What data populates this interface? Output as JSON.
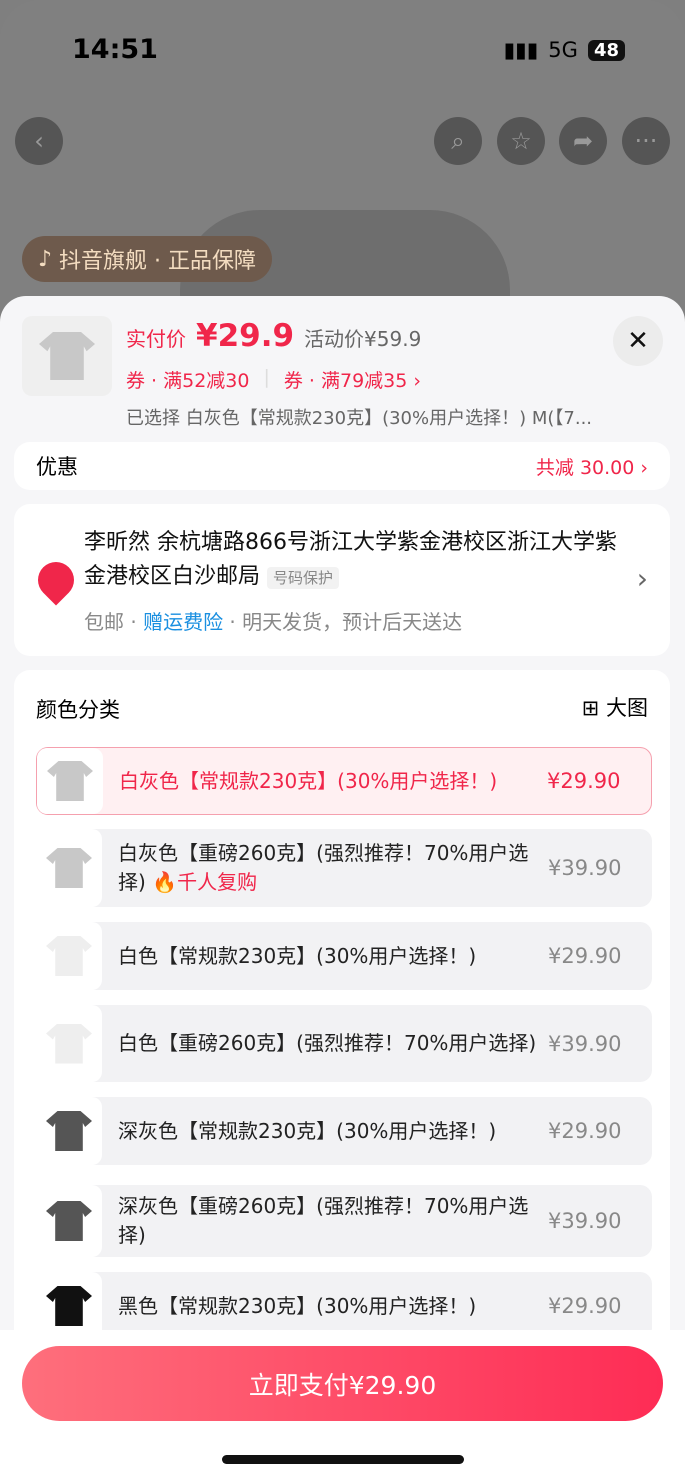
{
  "status": {
    "time": "14:51",
    "network": "5G",
    "battery": "48"
  },
  "header": {
    "badge": "抖音旗舰 · 正品保障"
  },
  "product": {
    "price_label": "实付价",
    "price": "¥29.9",
    "original": "活动价¥59.9",
    "coupon1": "券 · 满52减30",
    "coupon2": "券 · 满79减35 ›",
    "selected": "已选择 白灰色【常规款230克】(30%用户选择！) M(【7..."
  },
  "discount": {
    "label": "优惠",
    "value": "共减 30.00 ›"
  },
  "address": {
    "line": "李昕然  余杭塘路866号浙江大学紫金港校区浙江大学紫金港校区白沙邮局",
    "tag": "号码保护",
    "ship1": "包邮 · ",
    "ship_link": "赠运费险",
    "ship2": " · 明天发货，预计后天送达"
  },
  "variants": {
    "title": "颜色分类",
    "big": "大图",
    "items": [
      {
        "name": "白灰色【常规款230克】(30%用户选择！)",
        "price": "¥29.90",
        "color": "#c8c8c8",
        "selected": true
      },
      {
        "name": "白灰色【重磅260克】(强烈推荐！70%用户选择)",
        "extra": "千人复购",
        "price": "¥39.90",
        "color": "#c8c8c8"
      },
      {
        "name": "白色【常规款230克】(30%用户选择！)",
        "price": "¥29.90",
        "color": "#eeeeee"
      },
      {
        "name": "白色【重磅260克】(强烈推荐！70%用户选择)",
        "price": "¥39.90",
        "color": "#eeeeee"
      },
      {
        "name": "深灰色【常规款230克】(30%用户选择！)",
        "price": "¥29.90",
        "color": "#555555"
      },
      {
        "name": "深灰色【重磅260克】(强烈推荐！70%用户选择)",
        "price": "¥39.90",
        "color": "#555555"
      },
      {
        "name": "黑色【常规款230克】(30%用户选择！)",
        "price": "¥29.90",
        "color": "#111111"
      }
    ]
  },
  "pay": {
    "label": "立即支付¥29.90"
  },
  "colors": {
    "accent": "#fe2c55",
    "link": "#1a8fe0"
  }
}
